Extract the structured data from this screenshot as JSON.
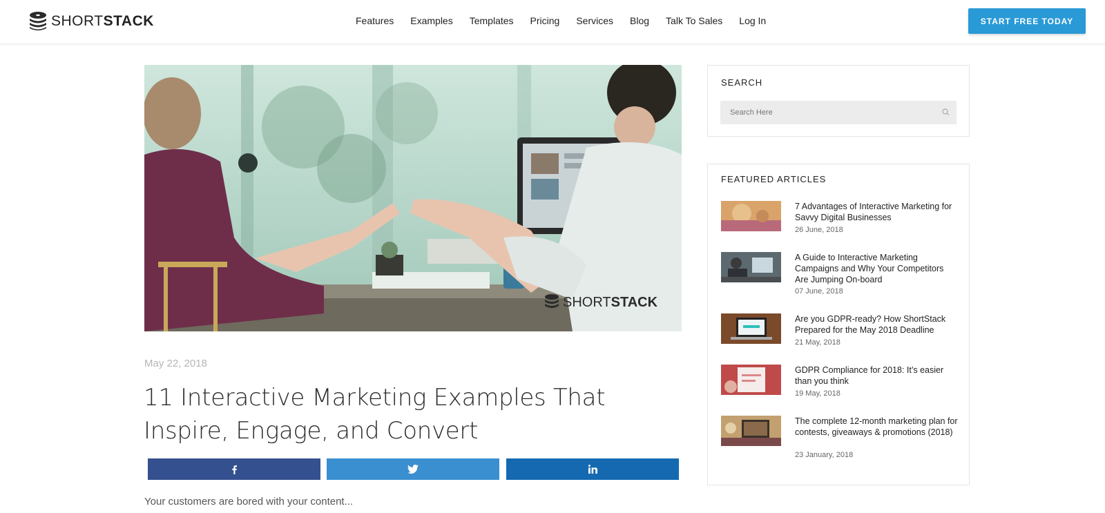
{
  "brand": {
    "name_light": "SHORT",
    "name_bold": "STACK",
    "accent": "#2a9ad6"
  },
  "nav": {
    "items": [
      "Features",
      "Examples",
      "Templates",
      "Pricing",
      "Services",
      "Blog",
      "Talk To Sales",
      "Log In"
    ],
    "cta": "START FREE TODAY"
  },
  "post": {
    "hero_watermark_light": "SHORT",
    "hero_watermark_bold": "STACK",
    "date": "May 22, 2018",
    "title": "11 Interactive Marketing Examples That Inspire, Engage, and Convert",
    "share": {
      "facebook_icon": "facebook-icon",
      "twitter_icon": "twitter-icon",
      "linkedin_icon": "linkedin-icon",
      "facebook_color": "#34508f",
      "twitter_color": "#3a8fd0",
      "linkedin_color": "#1469b0"
    },
    "intro": "Your customers are bored with your content..."
  },
  "sidebar": {
    "search": {
      "title": "SEARCH",
      "placeholder": "Search Here"
    },
    "featured": {
      "title": "FEATURED ARTICLES",
      "articles": [
        {
          "title": "7 Advantages of Interactive Marketing for Savvy Digital Businesses",
          "date": "26 June, 2018"
        },
        {
          "title": "A Guide to Interactive Marketing Campaigns and Why Your Competitors Are Jumping On-board",
          "date": "07 June, 2018"
        },
        {
          "title": "Are you GDPR-ready? How ShortStack Prepared for the May 2018 Deadline",
          "date": "21 May, 2018"
        },
        {
          "title": "GDPR Compliance for 2018: It’s easier than you think",
          "date": "19 May, 2018"
        },
        {
          "title": "The complete 12-month marketing plan for contests, giveaways & promotions (2018)",
          "date": "23 January, 2018"
        }
      ]
    }
  }
}
